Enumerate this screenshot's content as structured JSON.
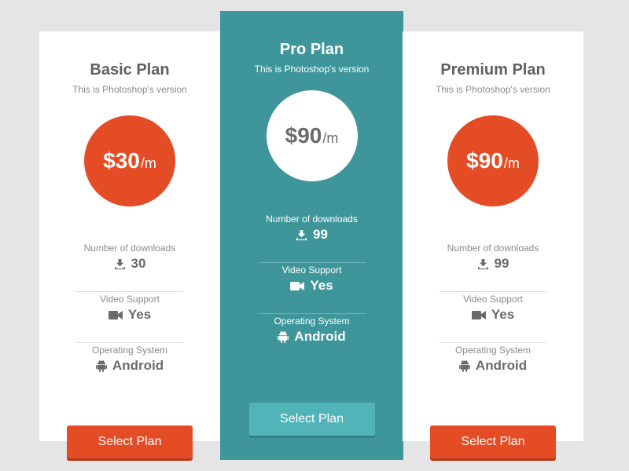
{
  "colors": {
    "background": "#e5e5e5",
    "card": "#ffffff",
    "featured": "#3e969b",
    "accent_red": "#e44c25",
    "accent_teal": "#52b3b9"
  },
  "plans": [
    {
      "title": "Basic Plan",
      "subtitle": "This is Photoshop's version",
      "price": "$30",
      "unit": "/m",
      "features": [
        {
          "label": "Number of downloads",
          "icon": "download-icon",
          "value": "30"
        },
        {
          "label": "Video Support",
          "icon": "video-camera-icon",
          "value": "Yes"
        },
        {
          "label": "Operating System",
          "icon": "android-icon",
          "value": "Android"
        }
      ],
      "button": "Select Plan"
    },
    {
      "title": "Pro Plan",
      "subtitle": "This is Photoshop's version",
      "price": "$90",
      "unit": "/m",
      "features": [
        {
          "label": "Number of downloads",
          "icon": "download-icon",
          "value": "99"
        },
        {
          "label": "Video Support",
          "icon": "video-camera-icon",
          "value": "Yes"
        },
        {
          "label": "Operating System",
          "icon": "android-icon",
          "value": "Android"
        }
      ],
      "button": "Select Plan"
    },
    {
      "title": "Premium Plan",
      "subtitle": "This is Photoshop's version",
      "price": "$90",
      "unit": "/m",
      "features": [
        {
          "label": "Number of downloads",
          "icon": "download-icon",
          "value": "99"
        },
        {
          "label": "Video Support",
          "icon": "video-camera-icon",
          "value": "Yes"
        },
        {
          "label": "Operating System",
          "icon": "android-icon",
          "value": "Android"
        }
      ],
      "button": "Select Plan"
    }
  ]
}
